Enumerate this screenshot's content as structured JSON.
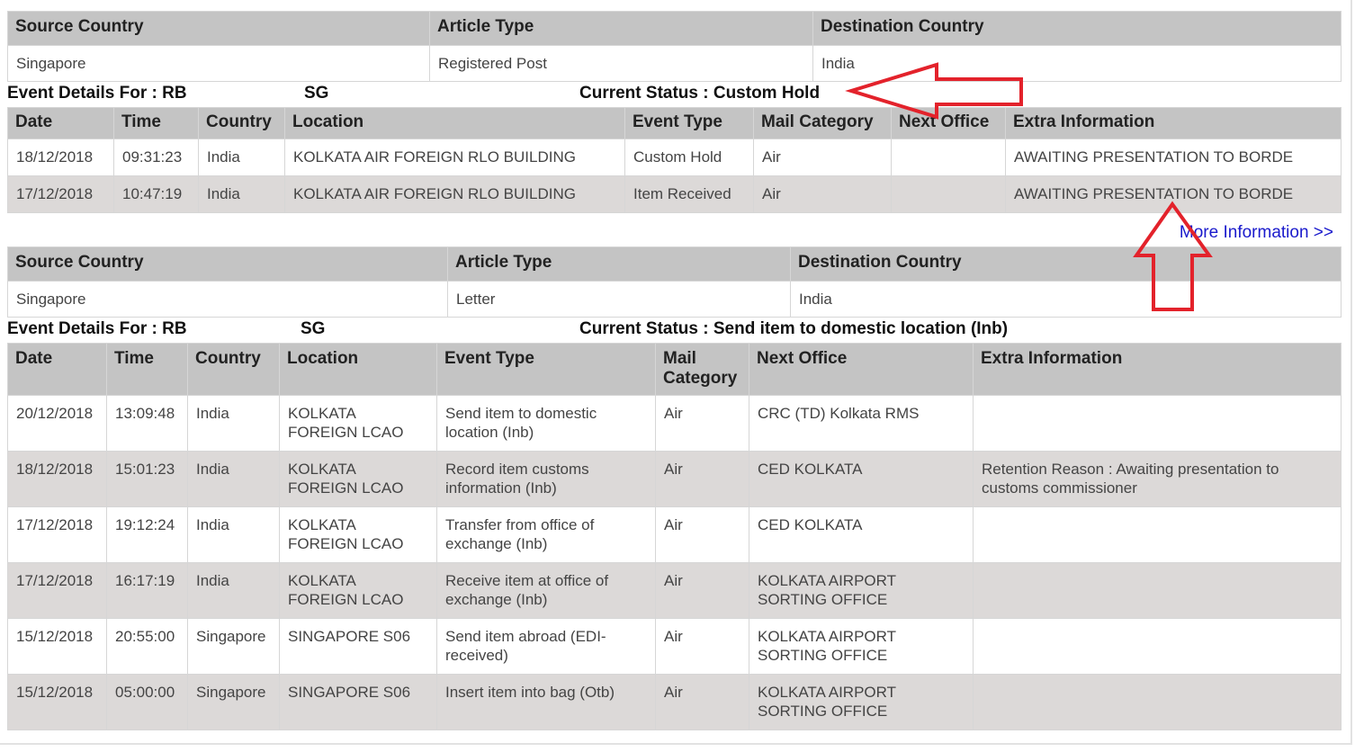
{
  "shipment1": {
    "info_headers": [
      "Source Country",
      "Article Type",
      "Destination Country"
    ],
    "info_values": [
      "Singapore",
      "Registered Post",
      "India"
    ],
    "event_label": "Event Details For :",
    "ref_prefix": "RB",
    "ref_suffix": "SG",
    "status": "Current Status : Custom Hold",
    "event_headers": [
      "Date",
      "Time",
      "Country",
      "Location",
      "Event Type",
      "Mail Category",
      "Next Office",
      "Extra Information"
    ],
    "events": [
      [
        "18/12/2018",
        "09:31:23",
        "India",
        "KOLKATA AIR FOREIGN RLO BUILDING",
        "Custom Hold",
        "Air",
        "",
        "AWAITING PRESENTATION TO BORDE"
      ],
      [
        "17/12/2018",
        "10:47:19",
        "India",
        "KOLKATA AIR FOREIGN RLO BUILDING",
        "Item Received",
        "Air",
        "",
        "AWAITING PRESENTATION TO BORDE"
      ]
    ],
    "more_link": "More Information >>"
  },
  "shipment2": {
    "info_headers": [
      "Source Country",
      "Article Type",
      "Destination Country"
    ],
    "info_values": [
      "Singapore",
      "Letter",
      "India"
    ],
    "event_label": "Event Details For :",
    "ref_prefix": "RB",
    "ref_suffix": "SG",
    "status": "Current Status : Send item to domestic location (Inb)",
    "event_headers": [
      "Date",
      "Time",
      "Country",
      "Location",
      "Event Type",
      "Mail Category",
      "Next Office",
      "Extra Information"
    ],
    "events": [
      [
        "20/12/2018",
        "13:09:48",
        "India",
        "KOLKATA FOREIGN LCAO",
        "Send item to domestic location (Inb)",
        "Air",
        "CRC (TD) Kolkata RMS",
        ""
      ],
      [
        "18/12/2018",
        "15:01:23",
        "India",
        "KOLKATA FOREIGN LCAO",
        "Record item customs information (Inb)",
        "Air",
        "CED KOLKATA",
        "Retention Reason : Awaiting presentation to customs commissioner"
      ],
      [
        "17/12/2018",
        "19:12:24",
        "India",
        "KOLKATA FOREIGN LCAO",
        "Transfer from office of exchange (Inb)",
        "Air",
        "CED KOLKATA",
        ""
      ],
      [
        "17/12/2018",
        "16:17:19",
        "India",
        "KOLKATA FOREIGN LCAO",
        "Receive item at office of exchange (Inb)",
        "Air",
        "KOLKATA AIRPORT SORTING OFFICE",
        ""
      ],
      [
        "15/12/2018",
        "20:55:00",
        "Singapore",
        "SINGAPORE S06",
        "Send item abroad (EDI-received)",
        "Air",
        "KOLKATA AIRPORT SORTING OFFICE",
        ""
      ],
      [
        "15/12/2018",
        "05:00:00",
        "Singapore",
        "SINGAPORE S06",
        "Insert item into bag (Otb)",
        "Air",
        "KOLKATA AIRPORT SORTING OFFICE",
        ""
      ]
    ]
  },
  "colors": {
    "header_bg": "#c4c4c4",
    "alt_row_bg": "#dcd9d8",
    "link": "#1a1acc",
    "annotation_arrow": "#e3222b"
  },
  "annotations": [
    "arrow-left-pointing-to-status",
    "arrow-up-pointing-to-extra-info"
  ]
}
